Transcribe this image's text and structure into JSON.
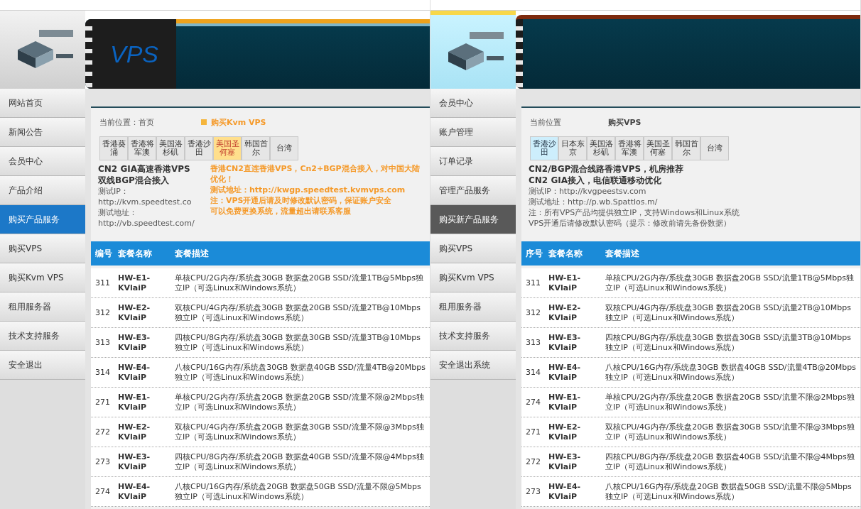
{
  "panels": [
    {
      "banner": {
        "title": "VPS"
      },
      "sidebar": {
        "items": [
          {
            "label": "网站首页",
            "selected": false
          },
          {
            "label": "新闻公告",
            "selected": false
          },
          {
            "label": "会员中心",
            "selected": false
          },
          {
            "label": "产品介绍",
            "selected": false
          },
          {
            "label": "购买产品服务",
            "selected": true
          },
          {
            "label": "购买VPS",
            "selected": false
          },
          {
            "label": "购买Kvm VPS",
            "selected": false
          },
          {
            "label": "租用服务器",
            "selected": false
          },
          {
            "label": "技术支持服务",
            "selected": false
          },
          {
            "label": "安全退出",
            "selected": false
          }
        ]
      },
      "breadcrumb": {
        "text": "当前位置：首页",
        "current": "购买Kvm VPS",
        "highlighted": true
      },
      "tabs": [
        {
          "label": "香港葵涌",
          "selected": false
        },
        {
          "label": "香港将军澳",
          "selected": false
        },
        {
          "label": "美国洛杉矶",
          "selected": false
        },
        {
          "label": "香港沙田",
          "selected": false
        },
        {
          "label": "美国圣何塞",
          "selected": true
        },
        {
          "label": "韩国首尔",
          "selected": false
        },
        {
          "label": "台湾",
          "selected": false
        }
      ],
      "intro": [
        {
          "kind": "heading",
          "text": "CN2 GIA高速香港VPS"
        },
        {
          "kind": "heading",
          "text": "双线BGP混合接入"
        },
        {
          "kind": "text",
          "text": "测试IP：http://kvm.speedtest.co"
        },
        {
          "kind": "text",
          "text": "测试地址：http://vb.speedtest.com/"
        }
      ],
      "notice": [
        "香港CN2直连香港VPS，Cn2+BGP混合接入，对中国大陆优化！",
        "测试地址：http://kwgp.speedtest.kvmvps.com",
        "注：VPS开通后请及时修改默认密码，保证账户安全",
        "可以免费更换系统，流量超出请联系客服"
      ],
      "table": {
        "columns": [
          "编号",
          "套餐名称",
          "套餐描述"
        ],
        "rows": [
          {
            "id": "311",
            "name": "HW-E1-KVlaiP",
            "description": "单核CPU/2G内存/系统盘30GB 数据盘20GB SSD/流量1TB@5Mbps独立IP（可选Linux和Windows系统）"
          },
          {
            "id": "312",
            "name": "HW-E2-KVlaiP",
            "description": "双核CPU/4G内存/系统盘30GB 数据盘20GB SSD/流量2TB@10Mbps独立IP（可选Linux和Windows系统）"
          },
          {
            "id": "313",
            "name": "HW-E3-KVlaiP",
            "description": "四核CPU/8G内存/系统盘30GB 数据盘30GB SSD/流量3TB@10Mbps独立IP（可选Linux和Windows系统）"
          },
          {
            "id": "314",
            "name": "HW-E4-KVlaiP",
            "description": "八核CPU/16G内存/系统盘30GB 数据盘40GB SSD/流量4TB@20Mbps独立IP（可选Linux和Windows系统）"
          },
          {
            "id": "271",
            "name": "HW-E1-KVlaiP",
            "description": "单核CPU/2G内存/系统盘20GB 数据盘20GB SSD/流量不限@2Mbps独立IP（可选Linux和Windows系统）"
          },
          {
            "id": "272",
            "name": "HW-E2-KVlaiP",
            "description": "双核CPU/4G内存/系统盘20GB 数据盘30GB SSD/流量不限@3Mbps独立IP（可选Linux和Windows系统）"
          },
          {
            "id": "273",
            "name": "HW-E3-KVlaiP",
            "description": "四核CPU/8G内存/系统盘20GB 数据盘40GB SSD/流量不限@4Mbps独立IP（可选Linux和Windows系统）"
          },
          {
            "id": "274",
            "name": "HW-E4-KVlaiP",
            "description": "八核CPU/16G内存/系统盘20GB 数据盘50GB SSD/流量不限@5Mbps独立IP（可选Linux和Windows系统）"
          }
        ]
      }
    },
    {
      "sidebar": {
        "items": [
          {
            "label": "会员中心",
            "selected": false
          },
          {
            "label": "账户管理",
            "selected": false
          },
          {
            "label": "订单记录",
            "selected": false
          },
          {
            "label": "管理产品服务",
            "selected": false
          },
          {
            "label": "购买新产品服务",
            "selected": true
          },
          {
            "label": "购买VPS",
            "selected": false
          },
          {
            "label": "购买Kvm VPS",
            "selected": false
          },
          {
            "label": "租用服务器",
            "selected": false
          },
          {
            "label": "技术支持服务",
            "selected": false
          },
          {
            "label": "安全退出系统",
            "selected": false
          }
        ]
      },
      "breadcrumb": {
        "text": "当前位置",
        "current": "购买VPS",
        "highlighted": false
      },
      "tabs": [
        {
          "label": "香港沙田",
          "selected": true
        },
        {
          "label": "日本东京",
          "selected": false
        },
        {
          "label": "美国洛杉矶",
          "selected": false
        },
        {
          "label": "香港将军澳",
          "selected": false
        },
        {
          "label": "美国圣何塞",
          "selected": false
        },
        {
          "label": "韩国首尔",
          "selected": false
        },
        {
          "label": "台湾",
          "selected": false
        }
      ],
      "intro": [
        {
          "kind": "heading",
          "text": "CN2/BGP混合线路香港VPS，机房推荐"
        },
        {
          "kind": "heading",
          "text": "CN2 GIA接入，电信联通移动优化"
        },
        {
          "kind": "text",
          "text": "测试IP：http://kvgpeestsv.com"
        },
        {
          "kind": "text",
          "text": "测试地址：http://p.wb.Spattlos.m/"
        },
        {
          "kind": "text",
          "text": "注：所有VPS产品均提供独立IP，支持Windows和Linux系统"
        },
        {
          "kind": "text",
          "text": "VPS开通后请修改默认密码（提示：修改前请先备份数据）"
        }
      ],
      "table": {
        "columns": [
          "序号",
          "套餐名称",
          "套餐描述"
        ],
        "rows": [
          {
            "id": "311",
            "name": "HW-E1-KVlaiP",
            "description": "单核CPU/2G内存/系统盘30GB 数据盘20GB SSD/流量1TB@5Mbps独立IP（可选Linux和Windows系统）"
          },
          {
            "id": "312",
            "name": "HW-E2-KVlaiP",
            "description": "双核CPU/4G内存/系统盘30GB 数据盘20GB SSD/流量2TB@10Mbps独立IP（可选Linux和Windows系统）"
          },
          {
            "id": "313",
            "name": "HW-E3-KVlaiP",
            "description": "四核CPU/8G内存/系统盘30GB 数据盘30GB SSD/流量3TB@10Mbps独立IP（可选Linux和Windows系统）"
          },
          {
            "id": "314",
            "name": "HW-E4-KVlaiP",
            "description": "八核CPU/16G内存/系统盘30GB 数据盘40GB SSD/流量4TB@20Mbps独立IP（可选Linux和Windows系统）"
          },
          {
            "id": "274",
            "name": "HW-E1-KVlaiP",
            "description": "单核CPU/2G内存/系统盘20GB 数据盘20GB SSD/流量不限@2Mbps独立IP（可选Linux和Windows系统）"
          },
          {
            "id": "271",
            "name": "HW-E2-KVlaiP",
            "description": "双核CPU/4G内存/系统盘20GB 数据盘30GB SSD/流量不限@3Mbps独立IP（可选Linux和Windows系统）"
          },
          {
            "id": "272",
            "name": "HW-E3-KVlaiP",
            "description": "四核CPU/8G内存/系统盘20GB 数据盘40GB SSD/流量不限@4Mbps独立IP（可选Linux和Windows系统）"
          },
          {
            "id": "273",
            "name": "HW-E4-KVlaiP",
            "description": "八核CPU/16G内存/系统盘20GB 数据盘50GB SSD/流量不限@5Mbps独立IP（可选Linux和Windows系统）"
          }
        ]
      }
    }
  ]
}
